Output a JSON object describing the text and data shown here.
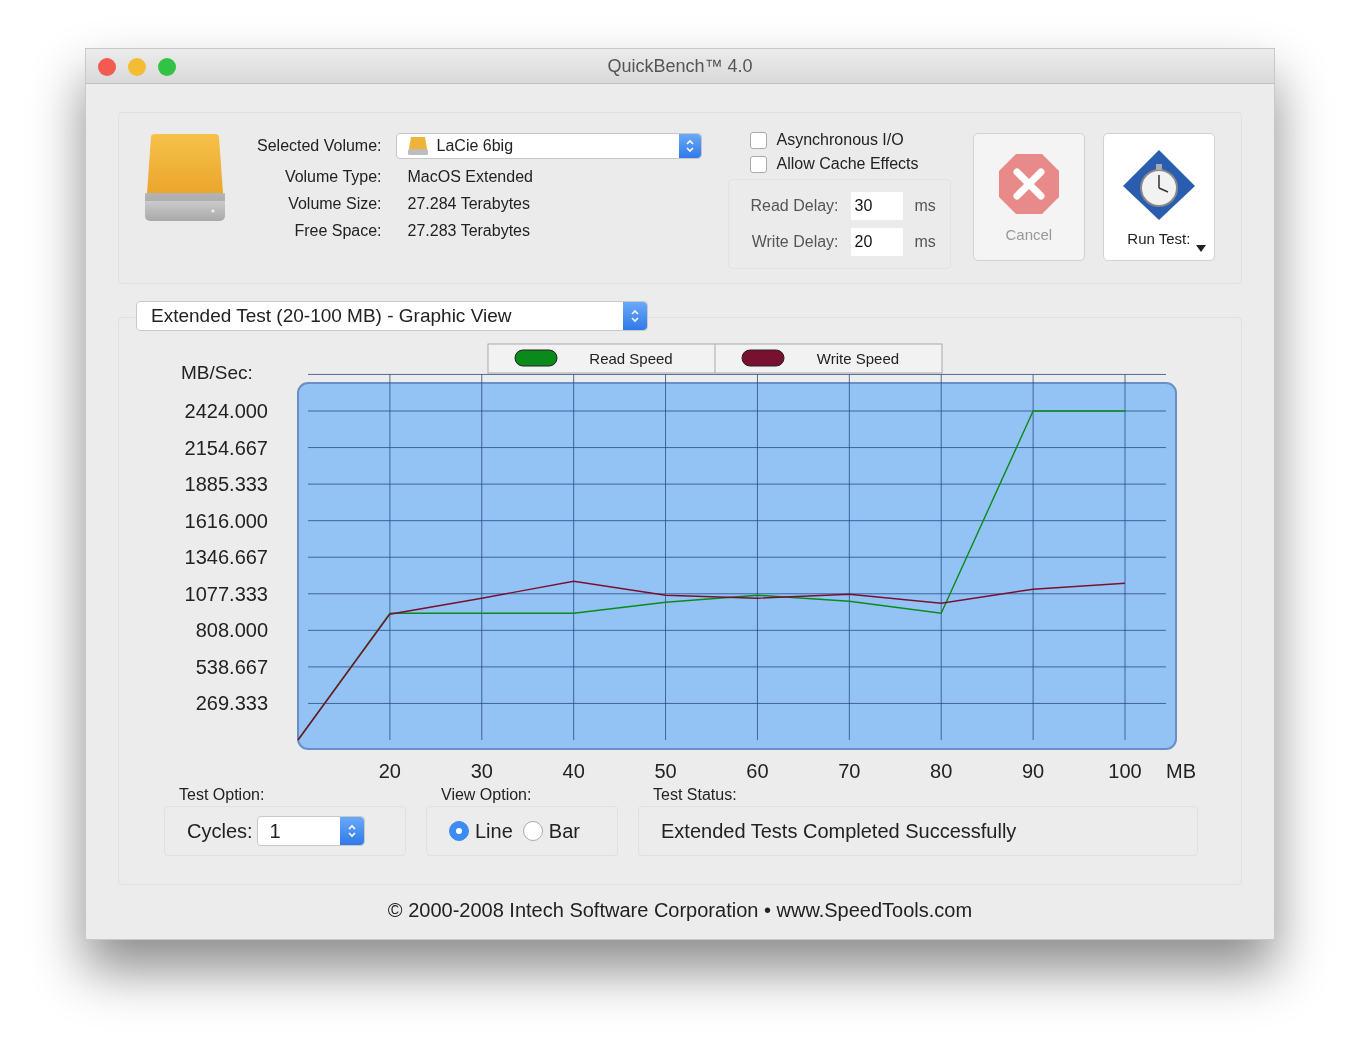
{
  "window": {
    "title": "QuickBench™ 4.0"
  },
  "volume": {
    "fields": [
      {
        "label": "Selected Volume:",
        "kind": "select",
        "value": "LaCie 6big"
      },
      {
        "label": "Volume Type:",
        "kind": "text",
        "value": "MacOS Extended"
      },
      {
        "label": "Volume Size:",
        "kind": "text",
        "value": "27.284 Terabytes"
      },
      {
        "label": "Free Space:",
        "kind": "text",
        "value": "27.283 Terabytes"
      }
    ]
  },
  "options": [
    {
      "label": "Asynchronous I/O",
      "checked": false
    },
    {
      "label": "Allow Cache Effects",
      "checked": false
    }
  ],
  "delays": [
    {
      "label": "Read Delay:",
      "value": "30",
      "unit": "ms"
    },
    {
      "label": "Write Delay:",
      "value": "20",
      "unit": "ms"
    }
  ],
  "buttons": [
    {
      "kind": "cancel",
      "label": "Cancel",
      "disabled": true
    },
    {
      "kind": "run",
      "label": "Run Test:",
      "disabled": false
    }
  ],
  "view_select": {
    "value": "Extended Test (20-100 MB) - Graphic View"
  },
  "chart_data": {
    "type": "line",
    "xlabel": "MB",
    "ylabel": "MB/Sec:",
    "x": [
      10,
      20,
      30,
      40,
      50,
      60,
      70,
      80,
      90,
      100
    ],
    "xlim": [
      10,
      100
    ],
    "grid": true,
    "legend": true,
    "ylim": [
      0,
      2693.333
    ],
    "xticks": [
      {
        "value": 20,
        "label": "20"
      },
      {
        "value": 30,
        "label": "30"
      },
      {
        "value": 40,
        "label": "40"
      },
      {
        "value": 50,
        "label": "50"
      },
      {
        "value": 60,
        "label": "60"
      },
      {
        "value": 70,
        "label": "70"
      },
      {
        "value": 80,
        "label": "80"
      },
      {
        "value": 90,
        "label": "90"
      },
      {
        "value": 100,
        "label": "100"
      }
    ],
    "yticks": [
      {
        "value": 269.333,
        "label": "269.333"
      },
      {
        "value": 538.667,
        "label": "538.667"
      },
      {
        "value": 808,
        "label": "808.000"
      },
      {
        "value": 1077.333,
        "label": "1077.333"
      },
      {
        "value": 1346.667,
        "label": "1346.667"
      },
      {
        "value": 1616,
        "label": "1616.000"
      },
      {
        "value": 1885.333,
        "label": "1885.333"
      },
      {
        "value": 2154.667,
        "label": "2154.667"
      },
      {
        "value": 2424,
        "label": "2424.000"
      }
    ],
    "series": [
      {
        "name": "Read Speed",
        "color": "#0a8a1a",
        "values": [
          0,
          934,
          934,
          934,
          1015,
          1067,
          1023,
          934,
          2424,
          2424
        ]
      },
      {
        "name": "Write Speed",
        "color": "#7a1030",
        "values": [
          0,
          927,
          1045,
          1170,
          1067,
          1045,
          1074,
          1008,
          1111,
          1155
        ]
      }
    ]
  },
  "test_option": {
    "label": "Test Option:",
    "cycles_label": "Cycles:",
    "cycles_value": "1"
  },
  "view_option": {
    "label": "View Option:",
    "choices": [
      {
        "label": "Line",
        "selected": true
      },
      {
        "label": "Bar",
        "selected": false
      }
    ]
  },
  "test_status": {
    "label": "Test Status:",
    "text": "Extended Tests Completed Successfully"
  },
  "footer": "© 2000-2008 Intech Software Corporation • www.SpeedTools.com"
}
